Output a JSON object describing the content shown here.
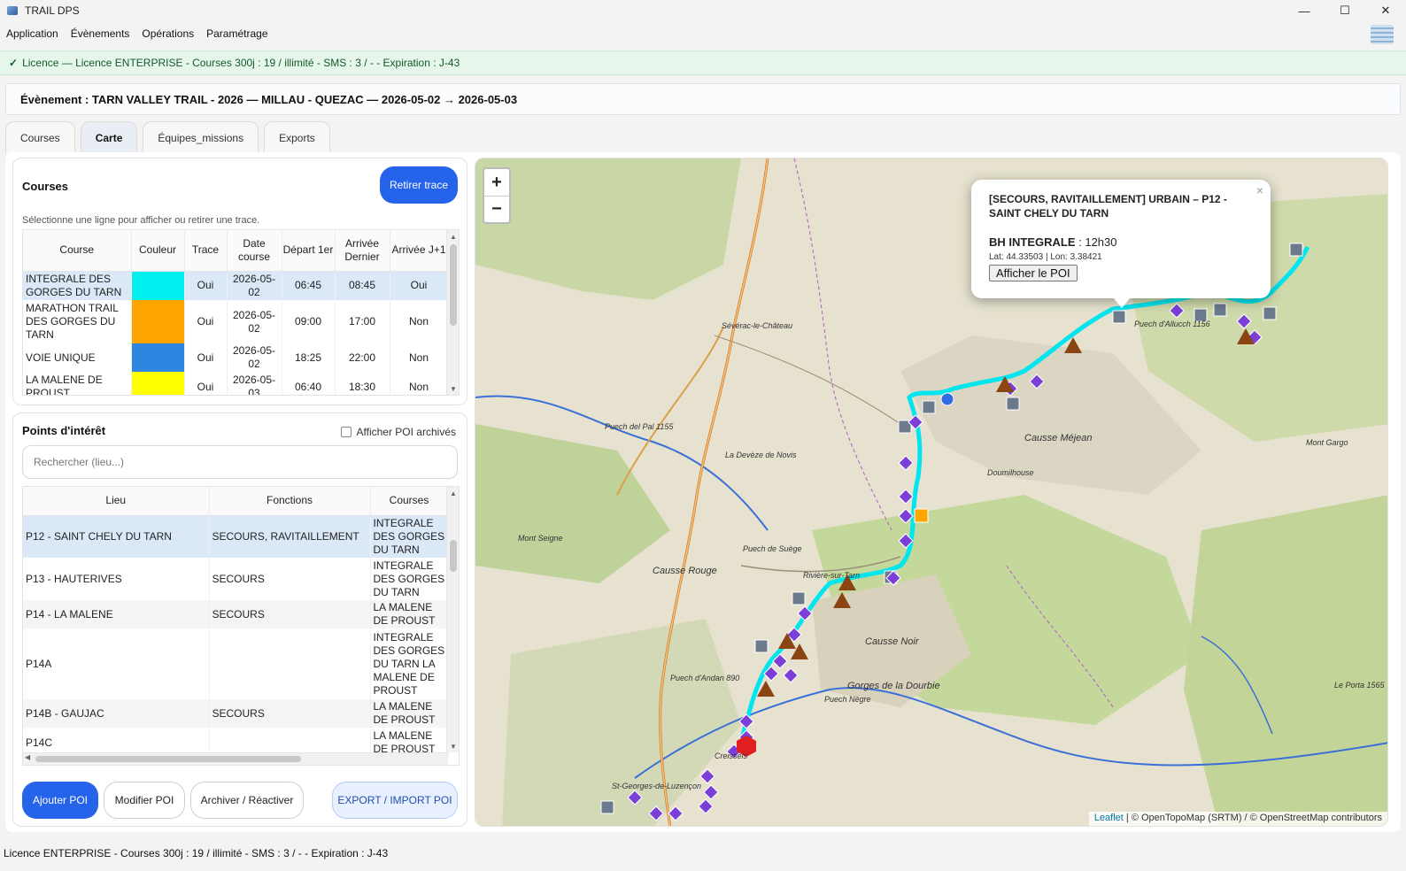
{
  "window": {
    "title": "TRAIL DPS",
    "minimize": "—",
    "maximize": "☐",
    "close": "✕"
  },
  "menu": [
    "Application",
    "Évènements",
    "Opérations",
    "Paramétrage"
  ],
  "licence_banner": {
    "check": "✓",
    "text": "Licence — Licence ENTERPRISE - Courses 300j : 19 / illimité - SMS : 3 / - - Expiration : J-43"
  },
  "event_header": "Évènement : TARN VALLEY TRAIL - 2026 — MILLAU - QUEZAC — 2026-05-02 → 2026-05-03",
  "tabs": [
    {
      "label": "Courses",
      "active": false
    },
    {
      "label": "Carte",
      "active": true
    },
    {
      "label": "Équipes_missions",
      "active": false
    },
    {
      "label": "Exports",
      "active": false
    }
  ],
  "courses_panel": {
    "title": "Courses",
    "remove_trace_button": "Retirer trace",
    "hint": "Sélectionne une ligne pour afficher ou retirer une trace.",
    "columns": [
      "Course",
      "Couleur",
      "Trace",
      "Date course",
      "Départ 1er",
      "Arrivée Dernier",
      "Arrivée J+1"
    ],
    "rows": [
      {
        "course": "INTEGRALE DES GORGES DU TARN",
        "color": "#00f0f0",
        "trace": "Oui",
        "date": "2026-05-02",
        "depart": "06:45",
        "arrivee": "08:45",
        "j1": "Oui",
        "selected": true
      },
      {
        "course": "MARATHON TRAIL DES GORGES DU TARN",
        "color": "#ffa500",
        "trace": "Oui",
        "date": "2026-05-02",
        "depart": "09:00",
        "arrivee": "17:00",
        "j1": "Non"
      },
      {
        "course": "VOIE UNIQUE",
        "color": "#2f86e0",
        "trace": "Oui",
        "date": "2026-05-02",
        "depart": "18:25",
        "arrivee": "22:00",
        "j1": "Non"
      },
      {
        "course": "LA MALENE DE PROUST",
        "color": "#ffff00",
        "trace": "Oui",
        "date": "2026-05-03",
        "depart": "06:40",
        "arrivee": "18:30",
        "j1": "Non"
      }
    ]
  },
  "poi_panel": {
    "title": "Points d'intérêt",
    "show_archived": "Afficher POI archivés",
    "search_placeholder": "Rechercher (lieu...)",
    "columns": [
      "Lieu",
      "Fonctions",
      "Courses"
    ],
    "rows": [
      {
        "lieu": "P12 - SAINT CHELY DU TARN",
        "fonctions": "SECOURS, RAVITAILLEMENT",
        "courses": "INTEGRALE DES GORGES DU TARN",
        "selected": true
      },
      {
        "lieu": "P13 - HAUTERIVES",
        "fonctions": "SECOURS",
        "courses": "INTEGRALE DES GORGES DU TARN"
      },
      {
        "lieu": "P14 - LA MALENE",
        "fonctions": "SECOURS",
        "courses": "LA MALENE DE PROUST"
      },
      {
        "lieu": "P14A",
        "fonctions": "",
        "courses": "INTEGRALE DES GORGES DU TARN LA MALENE DE PROUST"
      },
      {
        "lieu": "P14B - GAUJAC",
        "fonctions": "SECOURS",
        "courses": "LA MALENE DE PROUST"
      },
      {
        "lieu": "P14C",
        "fonctions": "",
        "courses": "LA MALENE DE PROUST"
      }
    ],
    "buttons": {
      "add": "Ajouter POI",
      "edit": "Modifier POI",
      "archive": "Archiver / Réactiver",
      "export": "EXPORT / IMPORT POI"
    }
  },
  "map": {
    "zoom_in": "+",
    "zoom_out": "−",
    "popup": {
      "close": "×",
      "title": "[SECOURS, RAVITAILLEMENT] URBAIN – P12 - SAINT CHELY DU TARN",
      "line_label": "BH INTEGRALE",
      "line_value": ": 12h30",
      "coords": "Lat: 44.33503 | Lon: 3.38421",
      "button": "Afficher le POI"
    },
    "attribution": {
      "leaflet": "Leaflet",
      "rest": " | © OpenTopoMap (SRTM) / © OpenStreetMap contributors"
    },
    "labels": [
      "Sévérac-le-Château",
      "Puech del Pal 1155",
      "La Devèze de Novis",
      "Mont Seigne",
      "Puech de Suège",
      "Rivière-sur-Tarn",
      "Puech d'Andan 890",
      "Puech Nègre",
      "Doumilhouse",
      "Mont Gargo",
      "Puech d'Allucch 1156",
      "Le Porta 1565",
      "Creissels",
      "St-Georges-de-Luzençon",
      "Gorges de la Dourbie",
      "Causse Noir",
      "Causse Méjean",
      "Causse Rouge"
    ]
  },
  "statusbar": "Licence ENTERPRISE - Courses 300j : 19 / illimité - SMS : 3 / - - Expiration : J-43"
}
